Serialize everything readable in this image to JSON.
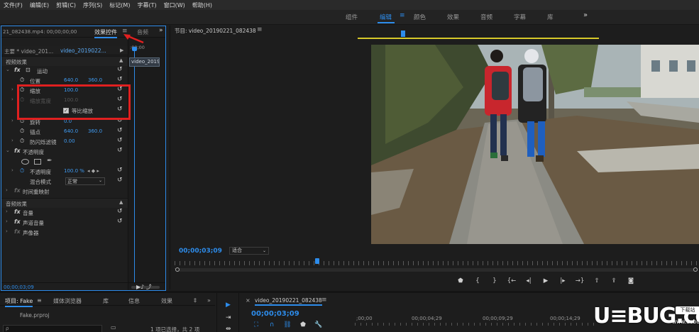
{
  "menu": [
    "文件(F)",
    "编辑(E)",
    "剪辑(C)",
    "序列(S)",
    "标记(M)",
    "字幕(T)",
    "窗口(W)",
    "帮助(H)"
  ],
  "workspaces": {
    "tabs": [
      "组件",
      "编辑",
      "颜色",
      "效果",
      "音频",
      "字幕",
      "库"
    ],
    "active": "编辑",
    "more": "»"
  },
  "effect_controls": {
    "clip_name": "21_082438.mp4: 00;00;00;00",
    "title": "效果控件",
    "menu_icon": "≡",
    "audio_tab": "音频",
    "more": "»",
    "master_label": "主要 * video_201...",
    "sequence_label": "video_2019022...",
    "timeline_start": ":00;00",
    "clip_bar": "video_2019",
    "video_effects_header": "视频效果",
    "motion": {
      "label": "运动",
      "position": {
        "label": "位置",
        "x": "640.0",
        "y": "360.0"
      },
      "scale": {
        "label": "缩放",
        "value": "100.0"
      },
      "scale_width": {
        "label": "缩放宽度",
        "value": "100.0"
      },
      "uniform_scale": {
        "label": "等比缩放",
        "checked": true
      },
      "rotation": {
        "label": "旋转",
        "value": "0.0"
      },
      "anchor": {
        "label": "锚点",
        "x": "640.0",
        "y": "360.0"
      },
      "anti_flicker": {
        "label": "防闪烁滤镜",
        "value": "0.00"
      }
    },
    "opacity": {
      "label": "不透明度",
      "value_label": "不透明度",
      "value": "100.0 %",
      "blend_label": "混合模式",
      "blend_value": "正常"
    },
    "time_remap": "时间重映射",
    "audio_effects_header": "音频效果",
    "volume": "音量",
    "channel_volume": "声道音量",
    "panner": "声像器",
    "current_time": "00;00;03;09"
  },
  "program_monitor": {
    "title": "节目: video_20190221_082438",
    "menu_icon": "≡",
    "timecode": "00;00;03;09",
    "fit": "适合",
    "transport_icons": [
      "marker-icon",
      "in-point-icon",
      "out-point-icon",
      "go-to-in-icon",
      "step-back-icon",
      "play-icon",
      "step-forward-icon",
      "go-to-out-icon",
      "lift-icon",
      "extract-icon",
      "export-frame-icon"
    ]
  },
  "project": {
    "tabs": [
      "项目: Fake",
      "媒体浏览器",
      "库",
      "信息",
      "效果",
      "‡"
    ],
    "menu_icon": "≡",
    "file": "Fake.prproj",
    "search_placeholder": "ρ",
    "count": "1 项已选择，共 2 项"
  },
  "timeline": {
    "title": "video_20190221_082438",
    "menu_icon": "≡",
    "timecode": "00;00;03;09",
    "ruler": [
      ";00;00",
      "00;00;04;29",
      "00;00;09;29",
      "00;00;14;29"
    ]
  },
  "watermark": {
    "brand": "U≡BUG.com",
    "badge": "下载站",
    "domain": "www.uebug.com"
  },
  "colors": {
    "accent": "#2d8ceb",
    "annotation": "#e02020"
  }
}
